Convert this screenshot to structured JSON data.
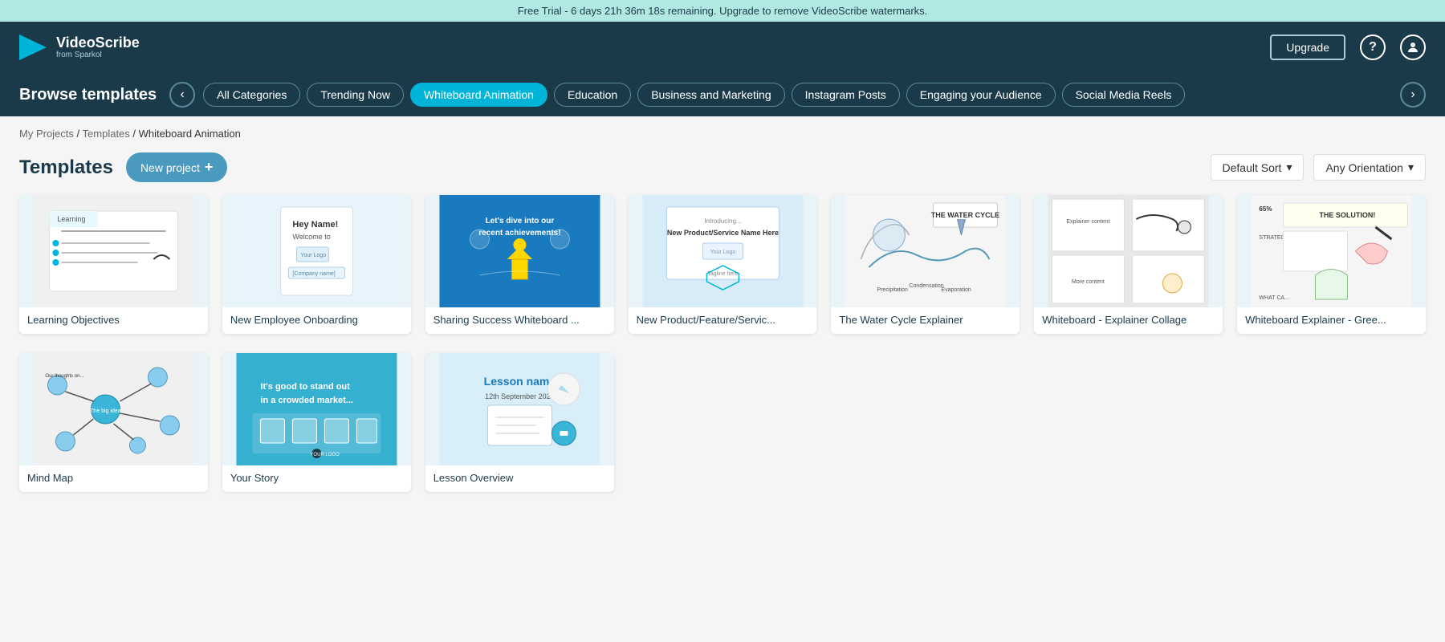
{
  "banner": {
    "text": "Free Trial - 6 days 21h 36m 18s remaining. Upgrade to remove VideoScribe watermarks."
  },
  "header": {
    "logo_text": "VideoScribe",
    "logo_sub": "from Sparkol",
    "upgrade_label": "Upgrade",
    "help_icon": "?",
    "account_icon": "👤"
  },
  "nav": {
    "browse_title": "Browse templates",
    "prev_arrow": "‹",
    "next_arrow": "›",
    "categories": [
      {
        "id": "all",
        "label": "All Categories",
        "active": false
      },
      {
        "id": "trending",
        "label": "Trending Now",
        "active": false
      },
      {
        "id": "whiteboard",
        "label": "Whiteboard Animation",
        "active": true
      },
      {
        "id": "education",
        "label": "Education",
        "active": false
      },
      {
        "id": "business",
        "label": "Business and Marketing",
        "active": false
      },
      {
        "id": "instagram",
        "label": "Instagram Posts",
        "active": false
      },
      {
        "id": "engaging",
        "label": "Engaging your Audience",
        "active": false
      },
      {
        "id": "social",
        "label": "Social Media Reels",
        "active": false
      }
    ]
  },
  "breadcrumb": {
    "parts": [
      "My Projects",
      "Templates",
      "Whiteboard Animation"
    ],
    "separators": [
      "/",
      "/"
    ]
  },
  "templates_section": {
    "title": "Templates",
    "new_project_label": "New project",
    "new_project_icon": "+",
    "sort_label": "Default Sort",
    "sort_arrow": "▾",
    "orientation_label": "Any Orientation",
    "orientation_arrow": "▾"
  },
  "templates_row1": [
    {
      "id": "learning-objectives",
      "name": "Learning Objectives",
      "thumb_type": "learning"
    },
    {
      "id": "new-employee-onboarding",
      "name": "New Employee Onboarding",
      "thumb_type": "onboarding"
    },
    {
      "id": "sharing-success",
      "name": "Sharing Success Whiteboard ...",
      "thumb_type": "sharing"
    },
    {
      "id": "new-product",
      "name": "New Product/Feature/Servic...",
      "thumb_type": "product"
    },
    {
      "id": "water-cycle",
      "name": "The Water Cycle Explainer",
      "thumb_type": "water"
    },
    {
      "id": "explainer-collage",
      "name": "Whiteboard - Explainer Collage",
      "thumb_type": "explager"
    },
    {
      "id": "whiteboard-explainer-green",
      "name": "Whiteboard Explainer - Gree...",
      "thumb_type": "green"
    }
  ],
  "templates_row2": [
    {
      "id": "mind-map",
      "name": "Mind Map",
      "thumb_type": "mindmap"
    },
    {
      "id": "your-story",
      "name": "Your Story",
      "thumb_type": "story"
    },
    {
      "id": "lesson-overview",
      "name": "Lesson Overview",
      "thumb_type": "lesson"
    }
  ]
}
